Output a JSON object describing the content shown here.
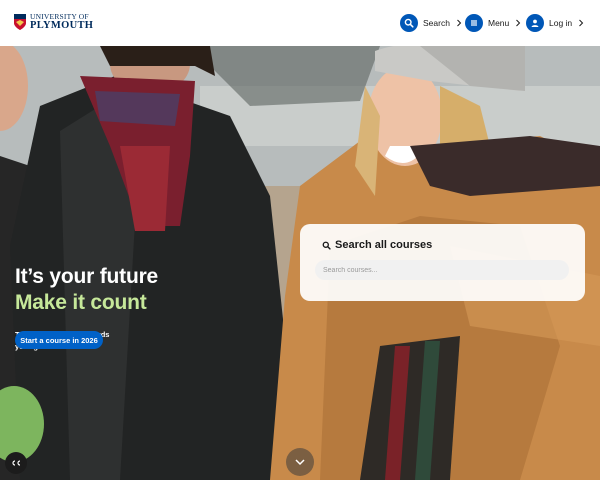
{
  "header": {
    "logo": {
      "line1": "UNIVERSITY OF",
      "line2": "PLYMOUTH"
    },
    "nav": [
      {
        "label": "Search",
        "icon": "search-icon"
      },
      {
        "label": "Menu",
        "icon": "menu-icon"
      },
      {
        "label": "Log in",
        "icon": "user-icon"
      }
    ]
  },
  "hero": {
    "headline1": "It’s your future",
    "headline2": "Make it count",
    "subtext": "Take the first step towards your goal",
    "cta_label": "Start a course in 2026"
  },
  "search_card": {
    "title": "Search all courses",
    "placeholder": "Search courses..."
  },
  "controls": {
    "captions_icon": "captions-icon",
    "scroll_down_icon": "chevron-down-icon"
  },
  "colors": {
    "brand_navy": "#002b5c",
    "nav_blue": "#0057b7",
    "cta_blue": "#0061c7",
    "headline_green": "#c6e89a"
  }
}
